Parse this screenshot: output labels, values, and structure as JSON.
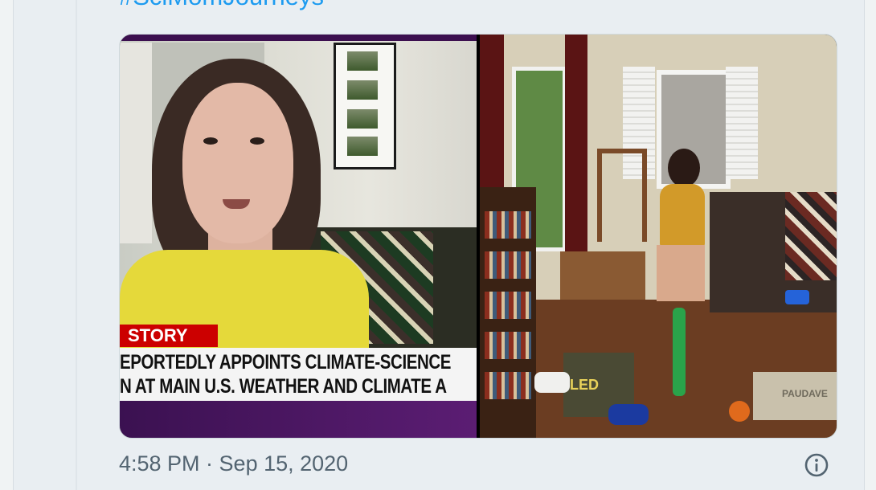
{
  "tweet": {
    "hashtag": "#SciMomJourneys",
    "timestamp": "4:58 PM · Sep 15, 2020"
  },
  "media": {
    "left_image": {
      "description": "news broadcast still",
      "chyron_label": "STORY",
      "chyron_line1": "EPORTEDLY APPOINTS CLIMATE-SCIENCE",
      "chyron_line2": "N AT MAIN U.S. WEATHER AND CLIMATE A"
    },
    "right_image": {
      "description": "home office photo",
      "box_text": "LED",
      "sign_text": "PAUDAVE"
    }
  },
  "icons": {
    "info": "info-icon"
  },
  "colors": {
    "link": "#1d9bf0",
    "meta_text": "#536471",
    "chyron_red": "#cc0000",
    "chyron_purple": "#3c0f4f"
  }
}
